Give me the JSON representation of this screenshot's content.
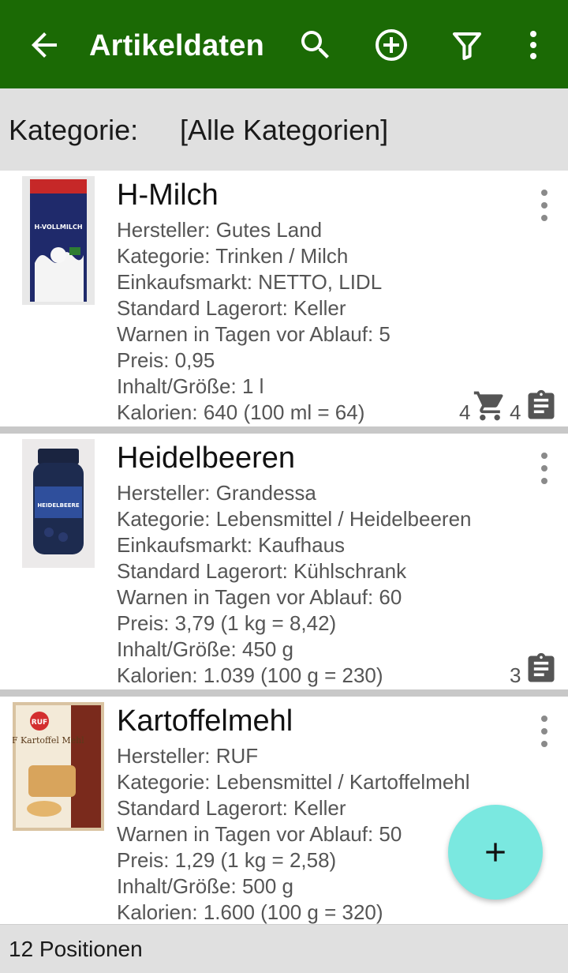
{
  "appbar": {
    "title": "Artikeldaten",
    "icons": [
      "back-arrow-icon",
      "search-icon",
      "add-circle-icon",
      "filter-icon",
      "overflow-menu-icon"
    ],
    "color": "#1b6a05"
  },
  "category": {
    "label": "Kategorie:",
    "value": "[Alle Kategorien]"
  },
  "items": [
    {
      "name": "H-Milch",
      "image_label": "H-VOLLMILCH",
      "fields": [
        "Hersteller: Gutes Land",
        "Kategorie: Trinken / Milch",
        "Einkaufsmarkt: NETTO, LIDL",
        "Standard Lagerort: Keller",
        "Warnen in Tagen vor Ablauf: 5",
        "Preis: 0,95",
        "Inhalt/Größe: 1 l",
        "Kalorien: 640 (100 ml = 64)"
      ],
      "cart_count": "4",
      "stock_count": "4"
    },
    {
      "name": "Heidelbeeren",
      "image_label": "HEIDELBEERE",
      "fields": [
        "Hersteller: Grandessa",
        "Kategorie: Lebensmittel / Heidelbeeren",
        "Einkaufsmarkt: Kaufhaus",
        "Standard Lagerort: Kühlschrank",
        "Warnen in Tagen vor Ablauf: 60",
        "Preis: 3,79 (1 kg = 8,42)",
        "Inhalt/Größe: 450 g",
        "Kalorien: 1.039 (100 g = 230)"
      ],
      "stock_count": "3"
    },
    {
      "name": "Kartoffelmehl",
      "image_label": "RUF Kartoffel Mehl",
      "fields": [
        "Hersteller: RUF",
        "Kategorie: Lebensmittel / Kartoffelmehl",
        "Standard Lagerort: Keller",
        "Warnen in Tagen vor Ablauf: 50",
        "Preis: 1,29 (1 kg = 2,58)",
        "Inhalt/Größe: 500 g",
        "Kalorien: 1.600 (100 g = 320)"
      ]
    }
  ],
  "fab": {
    "icon": "plus-icon",
    "color": "#7ae8e0"
  },
  "footer": {
    "text": "12 Positionen"
  }
}
